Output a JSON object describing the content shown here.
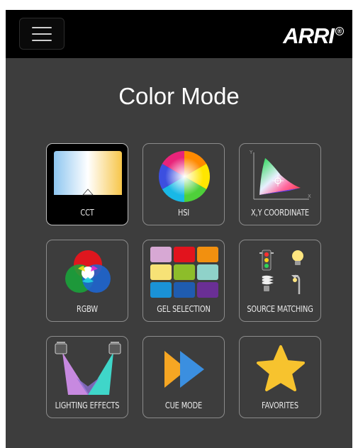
{
  "header": {
    "menu_icon": "hamburger-icon",
    "logo_text": "ARRI",
    "logo_mark": "®"
  },
  "page": {
    "title": "Color Mode"
  },
  "tiles": [
    {
      "id": "cct",
      "label": "CCT",
      "icon": "cct-gradient-icon",
      "selected": true
    },
    {
      "id": "hsi",
      "label": "HSI",
      "icon": "color-wheel-icon",
      "selected": false
    },
    {
      "id": "xy",
      "label": "X,Y COORDINATE",
      "icon": "cie-diagram-icon",
      "selected": false
    },
    {
      "id": "rgbw",
      "label": "RGBW",
      "icon": "rgb-circles-icon",
      "selected": false
    },
    {
      "id": "gel",
      "label": "GEL SELECTION",
      "icon": "gel-swatches-icon",
      "selected": false
    },
    {
      "id": "source",
      "label": "SOURCE MATCHING",
      "icon": "light-sources-icon",
      "selected": false
    },
    {
      "id": "effects",
      "label": "LIGHTING EFFECTS",
      "icon": "spotlights-icon",
      "selected": false
    },
    {
      "id": "cue",
      "label": "CUE MODE",
      "icon": "cue-play-icon",
      "selected": false
    },
    {
      "id": "fav",
      "label": "FAVORITES",
      "icon": "star-icon",
      "selected": false
    }
  ],
  "colors": {
    "background": "#3d3d3d",
    "topbar": "#000000",
    "selected_tile": "#000000",
    "tile_border": "#8b8b8b"
  }
}
